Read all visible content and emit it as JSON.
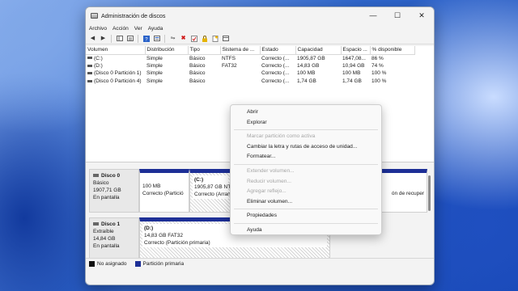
{
  "window": {
    "title": "Administración de discos",
    "controls": {
      "minimize": "—",
      "maximize": "☐",
      "close": "✕"
    }
  },
  "menu": [
    "Archivo",
    "Acción",
    "Ver",
    "Ayuda"
  ],
  "toolbar_icons": [
    "back-arrow-icon",
    "forward-arrow-icon",
    "console-tree-icon",
    "properties-icon",
    "help-icon",
    "list-view-icon",
    "connect-icon",
    "delete-icon",
    "check-icon",
    "lock-icon",
    "new-icon",
    "refresh-icon"
  ],
  "volumes": {
    "columns": [
      "Volumen",
      "Distribución",
      "Tipo",
      "Sistema de ...",
      "Estado",
      "Capacidad",
      "Espacio ...",
      "% disponible"
    ],
    "rows": [
      [
        "(C:)",
        "Simple",
        "Básico",
        "NTFS",
        "Correcto (...",
        "1905,87 GB",
        "1647,08...",
        "86 %"
      ],
      [
        "(D:)",
        "Simple",
        "Básico",
        "FAT32",
        "Correcto (...",
        "14,83 GB",
        "10,94 GB",
        "74 %"
      ],
      [
        "(Disco 0 Partición 1)",
        "Simple",
        "Básico",
        "",
        "Correcto (...",
        "100 MB",
        "100 MB",
        "100 %"
      ],
      [
        "(Disco 0 Partición 4)",
        "Simple",
        "Básico",
        "",
        "Correcto (...",
        "1,74 GB",
        "1,74 GB",
        "100 %"
      ]
    ]
  },
  "disks": [
    {
      "name": "Disco 0",
      "type": "Básico",
      "size": "1907,71 GB",
      "status": "En pantalla",
      "partitions": [
        {
          "label": "",
          "size": "100 MB",
          "status": "Correcto (Partició"
        },
        {
          "label": "(C:)",
          "size": "1905,87 GB NTF",
          "status": "Correcto (Arran"
        },
        {
          "label": "",
          "size": "",
          "status": "ón de recuper"
        }
      ]
    },
    {
      "name": "Disco 1",
      "type": "Extraíble",
      "size": "14,84 GB",
      "status": "En pantalla",
      "partitions": [
        {
          "label": "(D:)",
          "size": "14,83 GB FAT32",
          "status": "Correcto (Partición primaria)"
        }
      ]
    }
  ],
  "legend": [
    {
      "label": "No asignado",
      "color": "#111111"
    },
    {
      "label": "Partición primaria",
      "color": "#1d2f96"
    }
  ],
  "context_menu": {
    "items": [
      {
        "label": "Abrir",
        "enabled": true
      },
      {
        "label": "Explorar",
        "enabled": true
      },
      {
        "label": "Marcar partición como activa",
        "enabled": false
      },
      {
        "label": "Cambiar la letra y rutas de acceso de unidad...",
        "enabled": true
      },
      {
        "label": "Formatear...",
        "enabled": true
      },
      {
        "label": "Extender volumen...",
        "enabled": false
      },
      {
        "label": "Reducir volumen...",
        "enabled": false
      },
      {
        "label": "Agregar reflejo...",
        "enabled": false
      },
      {
        "label": "Eliminar volumen...",
        "enabled": true
      },
      {
        "label": "Propiedades",
        "enabled": true
      },
      {
        "label": "Ayuda",
        "enabled": true
      }
    ]
  }
}
